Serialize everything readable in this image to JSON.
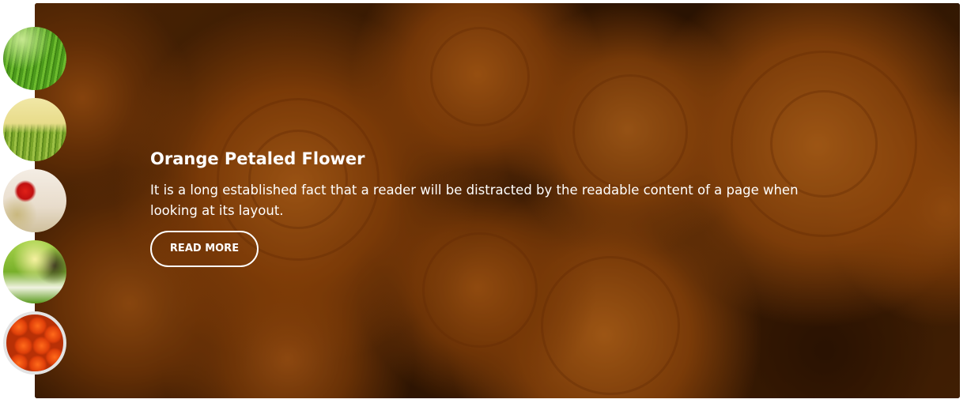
{
  "slider": {
    "active_index": 4,
    "slide": {
      "title": "Orange Petaled Flower",
      "text": "It is a long established fact that a reader will be distracted by the readable content of a page when looking at its layout.",
      "button_label": "READ MORE"
    },
    "thumbnails": [
      {
        "name": "grass-thumbnail"
      },
      {
        "name": "meadow-thumbnail"
      },
      {
        "name": "poppy-thumbnail"
      },
      {
        "name": "daisy-field-thumbnail"
      },
      {
        "name": "orange-roses-thumbnail"
      }
    ]
  },
  "colors": {
    "caption_text": "#ffffff",
    "active_thumb_border": "#e3e3e3",
    "rose_orange": "#d2731e"
  }
}
